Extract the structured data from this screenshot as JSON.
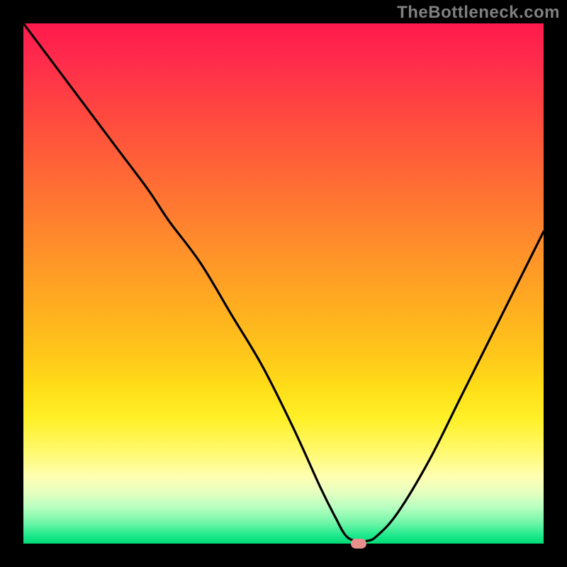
{
  "attribution": "TheBottleneck.com",
  "colors": {
    "page_bg": "#000000",
    "attribution_text": "#808080",
    "curve_stroke": "#000000",
    "marker_fill": "#e78f8d",
    "gradient_top": "#ff1a4d",
    "gradient_bottom": "#00d976"
  },
  "chart_data": {
    "type": "line",
    "title": "",
    "xlabel": "",
    "ylabel": "",
    "xlim": [
      0,
      100
    ],
    "ylim": [
      0,
      100
    ],
    "legend": false,
    "grid": false,
    "annotations": [
      {
        "kind": "marker",
        "x": 64.5,
        "y": 0,
        "shape": "rounded-rect",
        "color": "#e78f8d"
      }
    ],
    "series": [
      {
        "name": "bottleneck-curve",
        "color": "#000000",
        "x": [
          0,
          6,
          12,
          18,
          24,
          28,
          34,
          40,
          46,
          52,
          57,
          60,
          62,
          64,
          66,
          68,
          72,
          78,
          84,
          90,
          96,
          100
        ],
        "y": [
          100,
          92,
          84,
          76,
          68,
          62,
          54,
          44,
          34,
          22,
          11,
          5,
          1.5,
          0.5,
          0.5,
          1.5,
          6,
          16,
          28,
          40,
          52,
          60
        ]
      }
    ]
  }
}
